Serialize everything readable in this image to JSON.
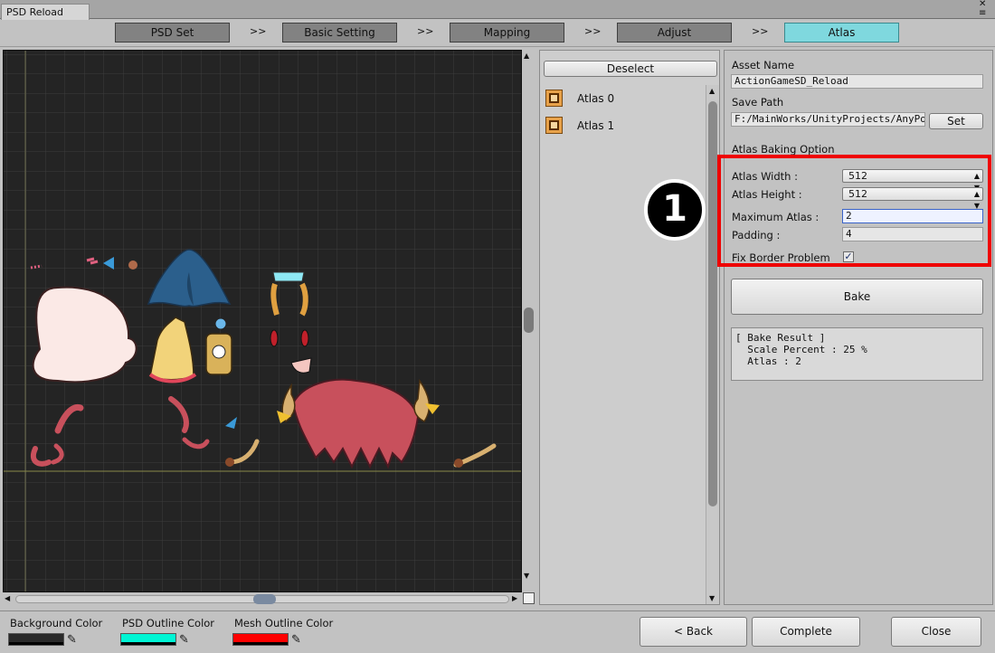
{
  "window": {
    "tab_title": "PSD Reload",
    "menu_glyph": "≡",
    "close_glyph": "✕"
  },
  "steps": {
    "items": [
      {
        "label": "PSD Set"
      },
      {
        "label": "Basic Setting"
      },
      {
        "label": "Mapping"
      },
      {
        "label": "Adjust"
      },
      {
        "label": "Atlas",
        "active": true
      }
    ],
    "separator": ">>"
  },
  "atlas_list": {
    "deselect_label": "Deselect",
    "items": [
      {
        "label": "Atlas 0"
      },
      {
        "label": "Atlas 1"
      }
    ]
  },
  "settings": {
    "asset_name_label": "Asset Name",
    "asset_name_value": "ActionGameSD_Reload",
    "save_path_label": "Save Path",
    "save_path_value": "F:/MainWorks/UnityProjects/AnyPortr",
    "set_label": "Set",
    "baking_option_label": "Atlas Baking Option",
    "atlas_width_label": "Atlas Width :",
    "atlas_width_value": "512",
    "atlas_height_label": "Atlas Height :",
    "atlas_height_value": "512",
    "maximum_atlas_label": "Maximum Atlas :",
    "maximum_atlas_value": "2",
    "padding_label": "Padding :",
    "padding_value": "4",
    "fix_border_label": "Fix Border Problem",
    "fix_border_checked": true,
    "bake_label": "Bake",
    "callout_number": "1",
    "highlight_color": "#ef0000"
  },
  "bake_result": {
    "title": "[ Bake Result ]",
    "scale_line": "  Scale Percent : 25 %",
    "atlas_line": "  Atlas : 2"
  },
  "bottom": {
    "background_color_label": "Background Color",
    "background_color": "#2a2a2a",
    "psd_outline_label": "PSD Outline Color",
    "psd_outline_color": "#00f5d4",
    "mesh_outline_label": "Mesh Outline Color",
    "mesh_outline_color": "#ff0000",
    "back_label": "< Back",
    "complete_label": "Complete",
    "close_label": "Close"
  },
  "colors": {
    "viewport_bg": "#242424",
    "active_step": "#7fd8de",
    "step_inactive": "#828282"
  }
}
